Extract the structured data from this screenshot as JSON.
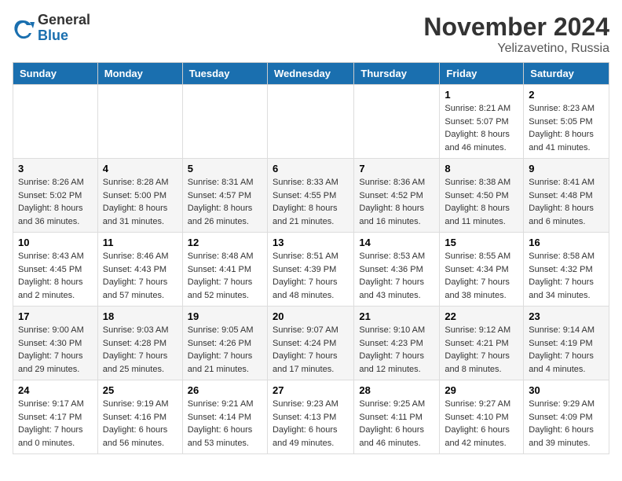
{
  "header": {
    "logo_general": "General",
    "logo_blue": "Blue",
    "month_title": "November 2024",
    "location": "Yelizavetino, Russia"
  },
  "days_of_week": [
    "Sunday",
    "Monday",
    "Tuesday",
    "Wednesday",
    "Thursday",
    "Friday",
    "Saturday"
  ],
  "weeks": [
    [
      {
        "day": "",
        "info": ""
      },
      {
        "day": "",
        "info": ""
      },
      {
        "day": "",
        "info": ""
      },
      {
        "day": "",
        "info": ""
      },
      {
        "day": "",
        "info": ""
      },
      {
        "day": "1",
        "info": "Sunrise: 8:21 AM\nSunset: 5:07 PM\nDaylight: 8 hours and 46 minutes."
      },
      {
        "day": "2",
        "info": "Sunrise: 8:23 AM\nSunset: 5:05 PM\nDaylight: 8 hours and 41 minutes."
      }
    ],
    [
      {
        "day": "3",
        "info": "Sunrise: 8:26 AM\nSunset: 5:02 PM\nDaylight: 8 hours and 36 minutes."
      },
      {
        "day": "4",
        "info": "Sunrise: 8:28 AM\nSunset: 5:00 PM\nDaylight: 8 hours and 31 minutes."
      },
      {
        "day": "5",
        "info": "Sunrise: 8:31 AM\nSunset: 4:57 PM\nDaylight: 8 hours and 26 minutes."
      },
      {
        "day": "6",
        "info": "Sunrise: 8:33 AM\nSunset: 4:55 PM\nDaylight: 8 hours and 21 minutes."
      },
      {
        "day": "7",
        "info": "Sunrise: 8:36 AM\nSunset: 4:52 PM\nDaylight: 8 hours and 16 minutes."
      },
      {
        "day": "8",
        "info": "Sunrise: 8:38 AM\nSunset: 4:50 PM\nDaylight: 8 hours and 11 minutes."
      },
      {
        "day": "9",
        "info": "Sunrise: 8:41 AM\nSunset: 4:48 PM\nDaylight: 8 hours and 6 minutes."
      }
    ],
    [
      {
        "day": "10",
        "info": "Sunrise: 8:43 AM\nSunset: 4:45 PM\nDaylight: 8 hours and 2 minutes."
      },
      {
        "day": "11",
        "info": "Sunrise: 8:46 AM\nSunset: 4:43 PM\nDaylight: 7 hours and 57 minutes."
      },
      {
        "day": "12",
        "info": "Sunrise: 8:48 AM\nSunset: 4:41 PM\nDaylight: 7 hours and 52 minutes."
      },
      {
        "day": "13",
        "info": "Sunrise: 8:51 AM\nSunset: 4:39 PM\nDaylight: 7 hours and 48 minutes."
      },
      {
        "day": "14",
        "info": "Sunrise: 8:53 AM\nSunset: 4:36 PM\nDaylight: 7 hours and 43 minutes."
      },
      {
        "day": "15",
        "info": "Sunrise: 8:55 AM\nSunset: 4:34 PM\nDaylight: 7 hours and 38 minutes."
      },
      {
        "day": "16",
        "info": "Sunrise: 8:58 AM\nSunset: 4:32 PM\nDaylight: 7 hours and 34 minutes."
      }
    ],
    [
      {
        "day": "17",
        "info": "Sunrise: 9:00 AM\nSunset: 4:30 PM\nDaylight: 7 hours and 29 minutes."
      },
      {
        "day": "18",
        "info": "Sunrise: 9:03 AM\nSunset: 4:28 PM\nDaylight: 7 hours and 25 minutes."
      },
      {
        "day": "19",
        "info": "Sunrise: 9:05 AM\nSunset: 4:26 PM\nDaylight: 7 hours and 21 minutes."
      },
      {
        "day": "20",
        "info": "Sunrise: 9:07 AM\nSunset: 4:24 PM\nDaylight: 7 hours and 17 minutes."
      },
      {
        "day": "21",
        "info": "Sunrise: 9:10 AM\nSunset: 4:23 PM\nDaylight: 7 hours and 12 minutes."
      },
      {
        "day": "22",
        "info": "Sunrise: 9:12 AM\nSunset: 4:21 PM\nDaylight: 7 hours and 8 minutes."
      },
      {
        "day": "23",
        "info": "Sunrise: 9:14 AM\nSunset: 4:19 PM\nDaylight: 7 hours and 4 minutes."
      }
    ],
    [
      {
        "day": "24",
        "info": "Sunrise: 9:17 AM\nSunset: 4:17 PM\nDaylight: 7 hours and 0 minutes."
      },
      {
        "day": "25",
        "info": "Sunrise: 9:19 AM\nSunset: 4:16 PM\nDaylight: 6 hours and 56 minutes."
      },
      {
        "day": "26",
        "info": "Sunrise: 9:21 AM\nSunset: 4:14 PM\nDaylight: 6 hours and 53 minutes."
      },
      {
        "day": "27",
        "info": "Sunrise: 9:23 AM\nSunset: 4:13 PM\nDaylight: 6 hours and 49 minutes."
      },
      {
        "day": "28",
        "info": "Sunrise: 9:25 AM\nSunset: 4:11 PM\nDaylight: 6 hours and 46 minutes."
      },
      {
        "day": "29",
        "info": "Sunrise: 9:27 AM\nSunset: 4:10 PM\nDaylight: 6 hours and 42 minutes."
      },
      {
        "day": "30",
        "info": "Sunrise: 9:29 AM\nSunset: 4:09 PM\nDaylight: 6 hours and 39 minutes."
      }
    ]
  ]
}
